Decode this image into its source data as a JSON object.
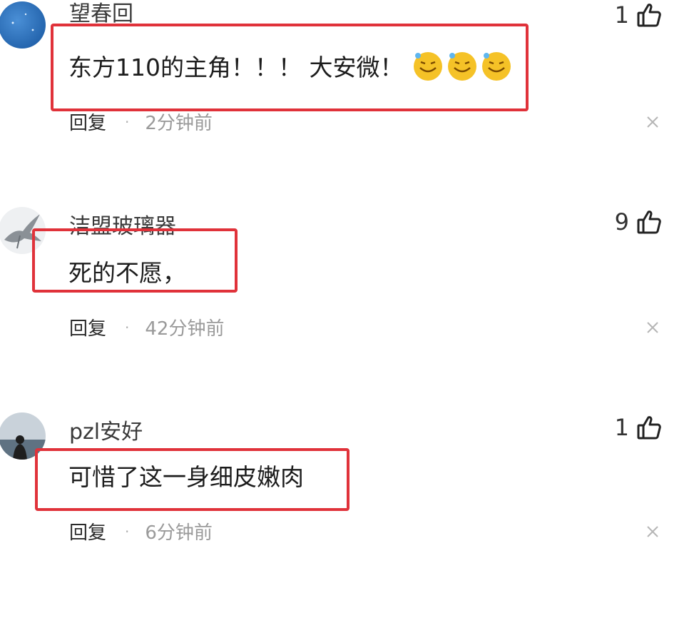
{
  "comments": [
    {
      "username": "望春回",
      "body": "东方110的主角！！！  大安微！",
      "emoji_icons": [
        "grinning-sweat-emoji",
        "grinning-sweat-emoji",
        "grinning-sweat-emoji"
      ],
      "likes": "1",
      "reply_label": "回复",
      "separator": "·",
      "time": "2分钟前",
      "avatar_icon": "avatar-blue-sky",
      "close_glyph": "×"
    },
    {
      "username": "洁盟玻璃器",
      "body": "死的不愿，",
      "likes": "9",
      "reply_label": "回复",
      "separator": "·",
      "time": "42分钟前",
      "avatar_icon": "avatar-bird-sketch",
      "close_glyph": "×"
    },
    {
      "username": "pzl安好",
      "body": "可惜了这一身细皮嫩肉",
      "likes": "1",
      "reply_label": "回复",
      "separator": "·",
      "time": "6分钟前",
      "avatar_icon": "avatar-person-sea",
      "close_glyph": "×"
    }
  ],
  "colors": {
    "highlight_box": "#e0323a",
    "meta_text": "#9a9a9a",
    "username_text": "#3a3a3a"
  }
}
